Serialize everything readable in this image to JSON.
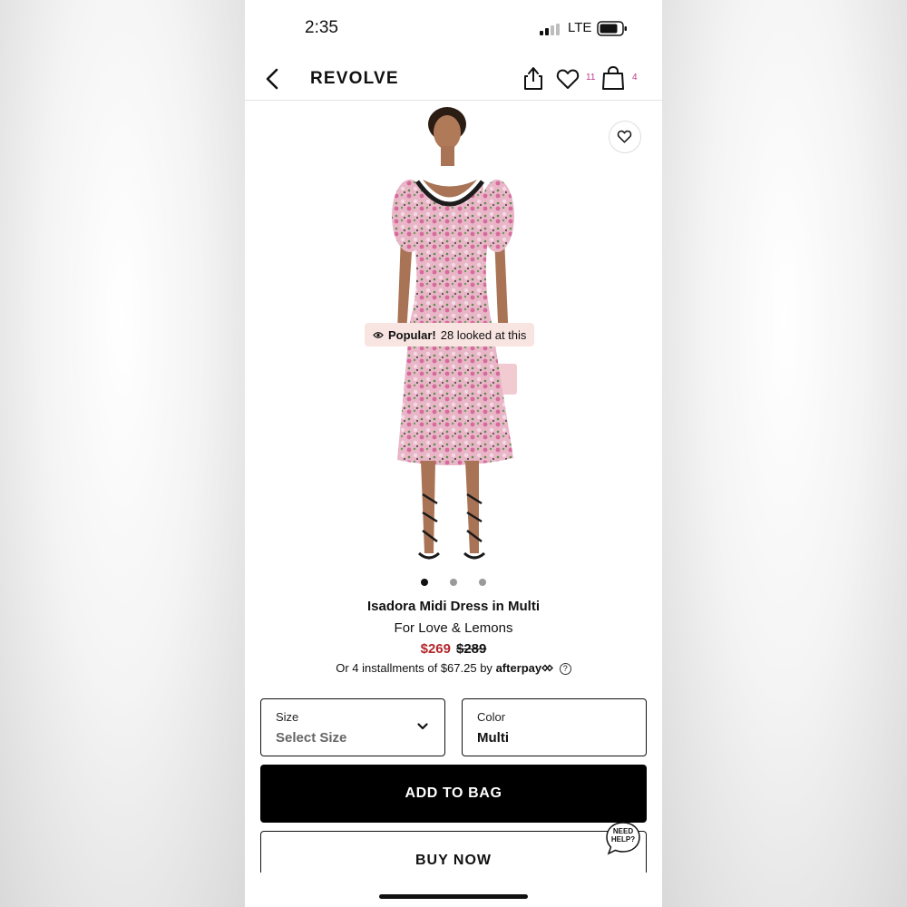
{
  "status_bar": {
    "time": "2:35",
    "network": "LTE"
  },
  "nav": {
    "brand": "REVOLVE",
    "wishlist_count": "11",
    "bag_count": "4"
  },
  "hero": {
    "popular_label": "Popular!",
    "popular_text": "28 looked at this",
    "carousel_total": 3,
    "carousel_active": 1
  },
  "product": {
    "title": "Isadora Midi Dress in Multi",
    "brand": "For Love & Lemons",
    "sale_price": "$269",
    "original_price": "$289",
    "installments_text": "Or 4 installments of $67.25 by",
    "afterpay_label": "afterpay",
    "help_symbol": "?"
  },
  "options": {
    "size_label": "Size",
    "size_value": "Select Size",
    "color_label": "Color",
    "color_value": "Multi"
  },
  "actions": {
    "add_to_bag": "ADD TO BAG",
    "buy_now": "BUY NOW",
    "need_help_line1": "NEED",
    "need_help_line2": "HELP?"
  },
  "colors": {
    "sale": "#b3262b",
    "badge_bg": "#f8e4e0",
    "counter": "#c0398d"
  }
}
